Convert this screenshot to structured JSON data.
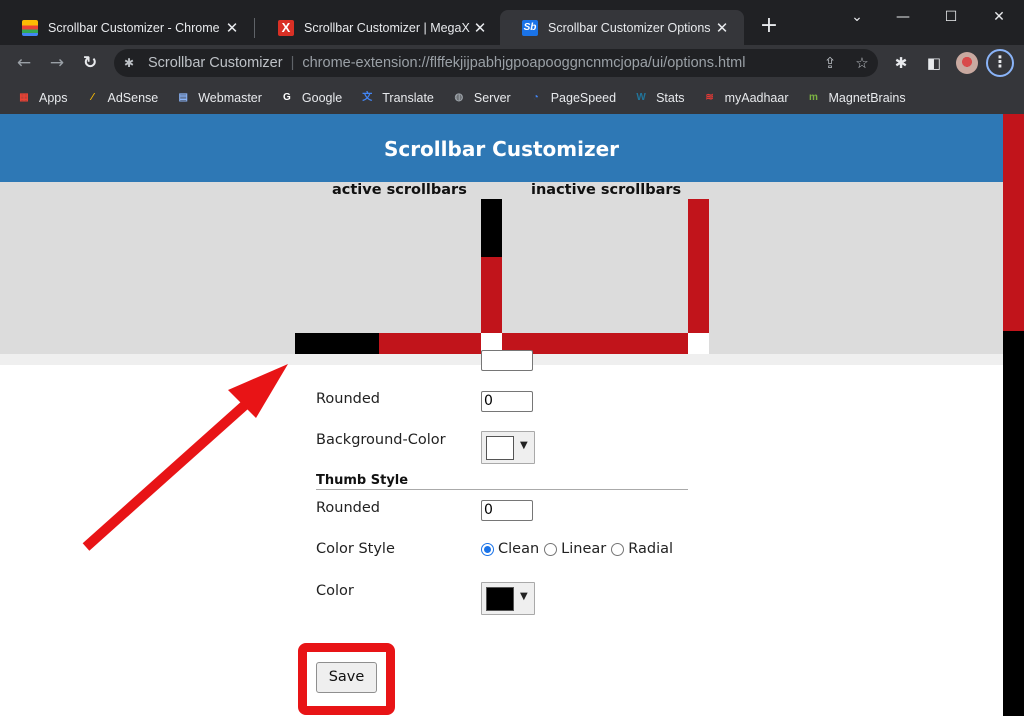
{
  "browser": {
    "tabs": [
      {
        "title": "Scrollbar Customizer - Chrome W",
        "favicon": "chrome-web-store-icon",
        "active": false
      },
      {
        "title": "Scrollbar Customizer | MegaXT -",
        "favicon": "megaxt-icon",
        "active": false
      },
      {
        "title": "Scrollbar Customizer Options",
        "favicon": "scrollbar-customizer-icon",
        "active": true
      }
    ],
    "favicon_text": {
      "megaxt": "X",
      "sb": "Sb"
    },
    "new_tab_glyph": "+",
    "window_controls": {
      "tab_search": "⌄",
      "minimize": "—",
      "maximize": "☐",
      "close": "✕"
    },
    "toolbar": {
      "back": "←",
      "forward": "→",
      "reload": "↻",
      "site_name": "Scrollbar Customizer",
      "separator": "|",
      "url": "chrome-extension://flffekjijpabhjgpoapooggncnmcjopa/ui/options.html",
      "share_glyph": "⇪",
      "star_glyph": "☆",
      "extensions_glyph": "✱",
      "sidepanel_glyph": "◧",
      "menu_glyph": "⋮"
    },
    "bookmarks": [
      {
        "label": "Apps",
        "icon": "apps-grid-icon",
        "color": "#ea4335"
      },
      {
        "label": "AdSense",
        "icon": "adsense-icon",
        "color": "#fbbc04"
      },
      {
        "label": "Webmaster",
        "icon": "webmaster-icon",
        "color": "#8ab4f8"
      },
      {
        "label": "Google",
        "icon": "google-icon",
        "color": "#ffffff"
      },
      {
        "label": "Translate",
        "icon": "translate-icon",
        "color": "#4285f4"
      },
      {
        "label": "Server",
        "icon": "globe-icon",
        "color": "#9aa0a6"
      },
      {
        "label": "PageSpeed",
        "icon": "pagespeed-icon",
        "color": "#4285f4"
      },
      {
        "label": "Stats",
        "icon": "wordpress-icon",
        "color": "#21759b"
      },
      {
        "label": "myAadhaar",
        "icon": "aadhaar-icon",
        "color": "#e53935"
      },
      {
        "label": "MagnetBrains",
        "icon": "magnetbrains-icon",
        "color": "#7cb342"
      }
    ],
    "bookmark_glyphs": [
      "▦",
      "⁄",
      "▤",
      "G",
      "文",
      "◍",
      "◔",
      "W",
      "≋",
      "m"
    ]
  },
  "page": {
    "title": "Scrollbar Customizer",
    "preview": {
      "active_label": "active scrollbars",
      "inactive_label": "inactive scrollbars",
      "colors": {
        "thumb": "#000000",
        "track": "#c1141b",
        "corner": "#ffffff",
        "background": "#dcdcdc"
      }
    },
    "track_style": {
      "rounded_label": "Rounded",
      "rounded_value": "0",
      "background_color_label": "Background-Color",
      "background_color_value": "#ffffff"
    },
    "thumb_style": {
      "section_title": "Thumb Style",
      "rounded_label": "Rounded",
      "rounded_value": "0",
      "color_style_label": "Color Style",
      "color_style_options": [
        "Clean",
        "Linear",
        "Radial"
      ],
      "color_style_selected": "Clean",
      "color_label": "Color",
      "color_value": "#000000"
    },
    "dropdown_glyph": "▼",
    "save_label": "Save"
  },
  "page_scrollbar": {
    "thumb_color": "#c1141b",
    "track_color": "#000000",
    "scroll_position_fraction": 0.0,
    "visible_fraction": 0.36
  },
  "annotations": {
    "arrow_color": "#e81416",
    "highlight_color": "#e81416"
  }
}
